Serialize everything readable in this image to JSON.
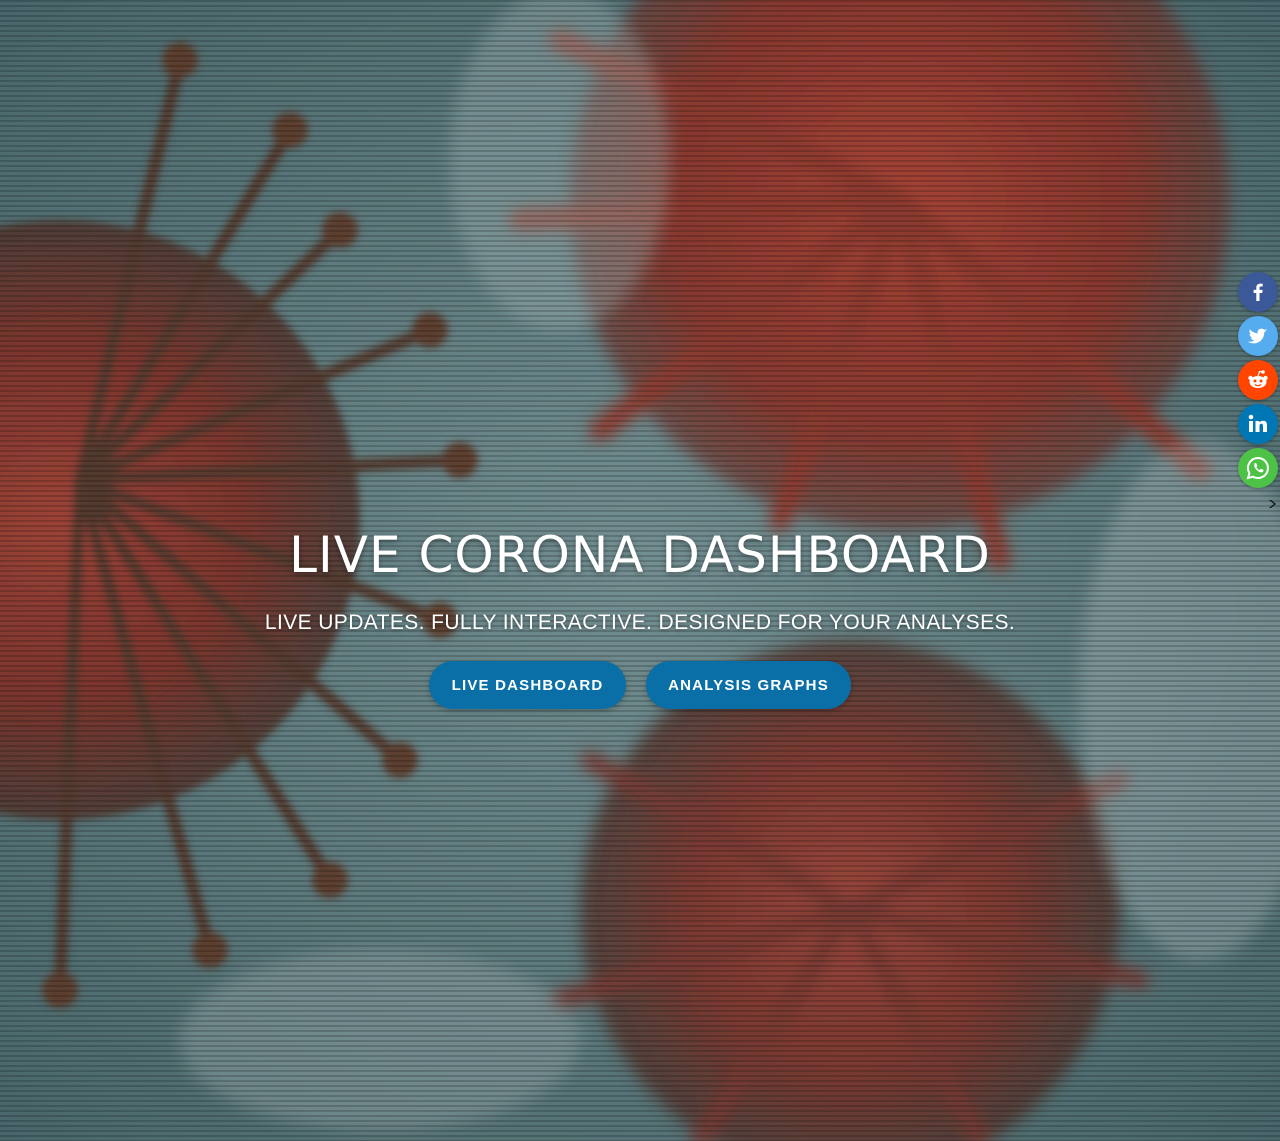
{
  "hero": {
    "title": "LIVE CORONA DASHBOARD",
    "subtitle": "LIVE UPDATES. FULLY INTERACTIVE. DESIGNED FOR YOUR ANALYSES.",
    "buttons": [
      {
        "label": "LIVE DASHBOARD"
      },
      {
        "label": "ANALYSIS GRAPHS"
      }
    ],
    "button_color": "#0b6fa7",
    "background_image": "coronavirus-particles-illustration"
  },
  "share_bar": {
    "items": [
      {
        "name": "Facebook",
        "icon": "facebook-icon",
        "color": "#3b5998"
      },
      {
        "name": "Twitter",
        "icon": "twitter-icon",
        "color": "#55acee"
      },
      {
        "name": "Reddit",
        "icon": "reddit-icon",
        "color": "#ff4500"
      },
      {
        "name": "Linkedin",
        "icon": "linkedin-icon",
        "color": "#0077b5"
      },
      {
        "name": "Whatsapp",
        "icon": "whatsapp-icon",
        "color": "#4dc247"
      }
    ],
    "hide_icon": "hide-chevron-icon"
  }
}
